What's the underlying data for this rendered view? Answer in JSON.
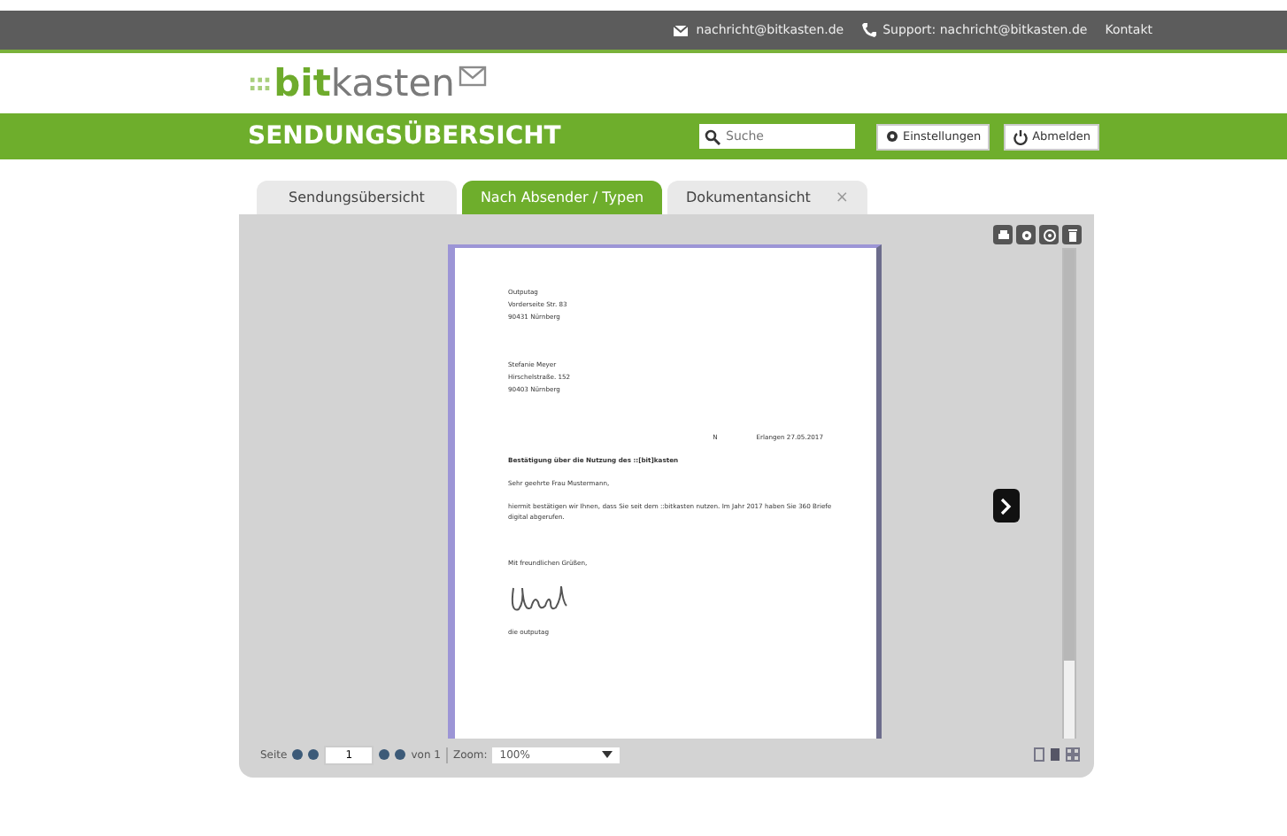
{
  "topbar": {
    "email": "nachricht@bitkasten.de",
    "support": "Support: nachricht@bitkasten.de",
    "contact": "Kontakt"
  },
  "logo": {
    "dots": ":::",
    "brand_bit": "bit",
    "brand_rest": "kasten"
  },
  "header": {
    "title": "SENDUNGSÜBERSICHT",
    "search": {
      "placeholder": "Suche"
    },
    "buttons": [
      "Einstellungen",
      "Abmelden"
    ]
  },
  "tabs": [
    {
      "label": "Sendungsübersicht",
      "selected": false,
      "closable": false
    },
    {
      "label": "Nach Absender / Typen",
      "selected": true,
      "closable": false
    },
    {
      "label": "Dokumentansicht",
      "selected": false,
      "closable": true,
      "close": "×"
    }
  ],
  "document": {
    "sender": [
      "Outputag",
      "Vorderseite Str. 83",
      "90431 Nürnberg"
    ],
    "recipient": [
      "Stefanie Meyer",
      "Hirschelstraße. 152",
      "90403 Nürnberg"
    ],
    "mark": "N",
    "date": "Erlangen 27.05.2017",
    "subject": "Bestätigung über die Nutzung des ::[bit]kasten",
    "greeting": "Sehr geehrte Frau Mustermann,",
    "body": "hiermit bestätigen wir Ihnen, dass Sie seit dem ::bitkasten nutzen. Im Jahr 2017 haben Sie 360 Briefe digital abgerufen.",
    "closing": "Mit freundlichen Grüßen,",
    "signer": "die outputag"
  },
  "scrollbar": {
    "level": 0.82
  },
  "pager": {
    "page_label": "Seite",
    "page": "1",
    "of": "von 1",
    "zoom_label": "Zoom:",
    "zoom": "100%"
  }
}
